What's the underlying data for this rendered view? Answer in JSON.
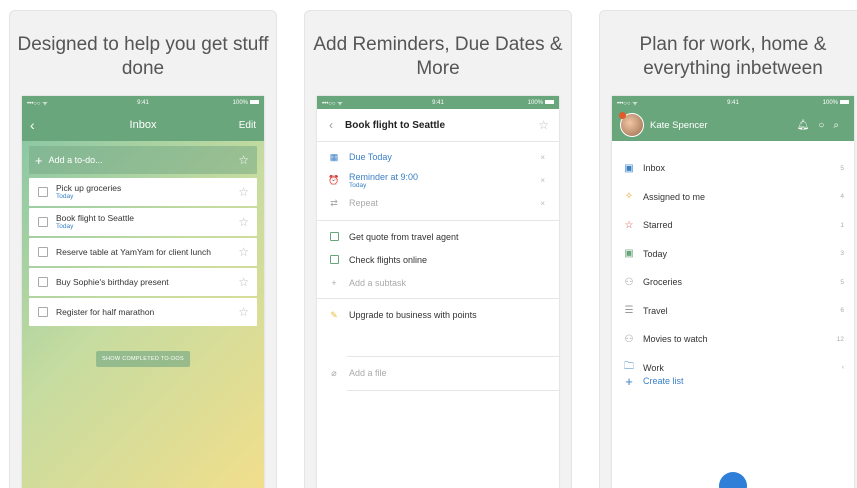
{
  "colors": {
    "accent": "#6aa67c",
    "link": "#3a80c6",
    "fab": "#2f7fd8"
  },
  "status": {
    "carrier": "•••○○ ᯤ",
    "time": "9:41",
    "battery": "100%"
  },
  "card1": {
    "title": "Designed to help you get stuff done",
    "nav": {
      "title": "Inbox",
      "edit": "Edit",
      "back_icon": "chevron-left-icon"
    },
    "add_placeholder": "Add a to-do...",
    "todos": [
      {
        "text": "Pick up groceries",
        "sub": "Today"
      },
      {
        "text": "Book flight to Seattle",
        "sub": "Today"
      },
      {
        "text": "Reserve table at YamYam for client lunch",
        "sub": ""
      },
      {
        "text": "Buy Sophie's birthday present",
        "sub": ""
      },
      {
        "text": "Register for half marathon",
        "sub": ""
      }
    ],
    "show_completed": "SHOW COMPLETED TO-DOS"
  },
  "card2": {
    "title": "Add Reminders, Due Dates & More",
    "task_title": "Book flight to Seattle",
    "due": "Due Today",
    "reminder": "Reminder at 9:00",
    "reminder_sub": "Today",
    "repeat": "Repeat",
    "subtasks": [
      "Get quote from travel agent",
      "Check flights online"
    ],
    "add_subtask": "Add a subtask",
    "note": "Upgrade to business with points",
    "add_file": "Add a file"
  },
  "card3": {
    "title": "Plan for work, home & everything inbetween",
    "user": "Kate Spencer",
    "lists": [
      {
        "label": "Inbox",
        "count": "5",
        "icon": "inbox-icon",
        "glyph": "▣",
        "color": "#3a80c6"
      },
      {
        "label": "Assigned to me",
        "count": "4",
        "icon": "assigned-icon",
        "glyph": "✧",
        "color": "#e8a33a"
      },
      {
        "label": "Starred",
        "count": "1",
        "icon": "star-icon",
        "glyph": "☆",
        "color": "#d9534f"
      },
      {
        "label": "Today",
        "count": "3",
        "icon": "calendar-icon",
        "glyph": "▣",
        "color": "#6aa67c"
      },
      {
        "label": "Groceries",
        "count": "5",
        "icon": "shared-list-icon",
        "glyph": "⚇",
        "color": "#999999"
      },
      {
        "label": "Travel",
        "count": "6",
        "icon": "list-icon",
        "glyph": "☰",
        "color": "#999999"
      },
      {
        "label": "Movies to watch",
        "count": "12",
        "icon": "shared-list-icon",
        "glyph": "⚇",
        "color": "#999999"
      },
      {
        "label": "Work",
        "count": "‹",
        "icon": "folder-icon",
        "glyph": "🗀",
        "color": "#3a80c6"
      }
    ],
    "create_list": "Create list"
  }
}
